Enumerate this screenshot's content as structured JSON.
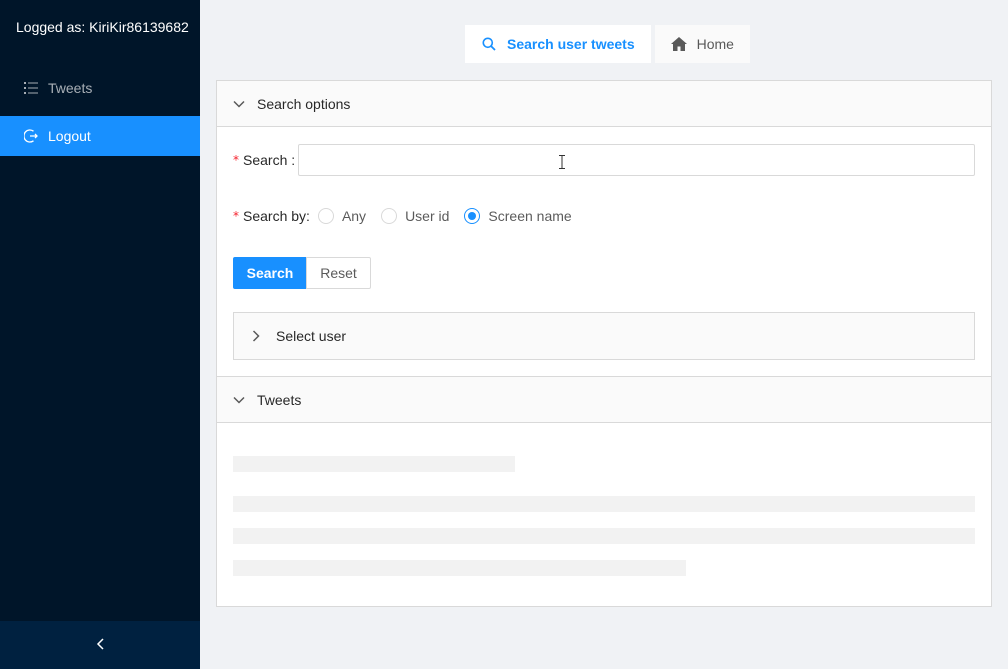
{
  "sidebar": {
    "logged_as": "Logged as: KiriKir86139682",
    "items": [
      {
        "label": "Tweets",
        "icon": "list-icon",
        "selected": false
      },
      {
        "label": "Logout",
        "icon": "logout-icon",
        "selected": true
      }
    ],
    "collapse_icon": "chevron-left-icon"
  },
  "topnav": {
    "tabs": [
      {
        "label": "Search user tweets",
        "icon": "search-icon",
        "active": true
      },
      {
        "label": "Home",
        "icon": "home-icon",
        "active": false
      }
    ]
  },
  "search_panel": {
    "header": "Search options",
    "search_label": "Search",
    "search_value": "",
    "search_by_label": "Search by",
    "options": [
      "Any",
      "User id",
      "Screen name"
    ],
    "selected_option": "Screen name",
    "search_button": "Search",
    "reset_button": "Reset",
    "select_user_header": "Select user"
  },
  "tweets_panel": {
    "header": "Tweets",
    "loading": true
  },
  "colors": {
    "sidebar_bg": "#001529",
    "primary": "#1890ff",
    "required": "#f5222d"
  }
}
